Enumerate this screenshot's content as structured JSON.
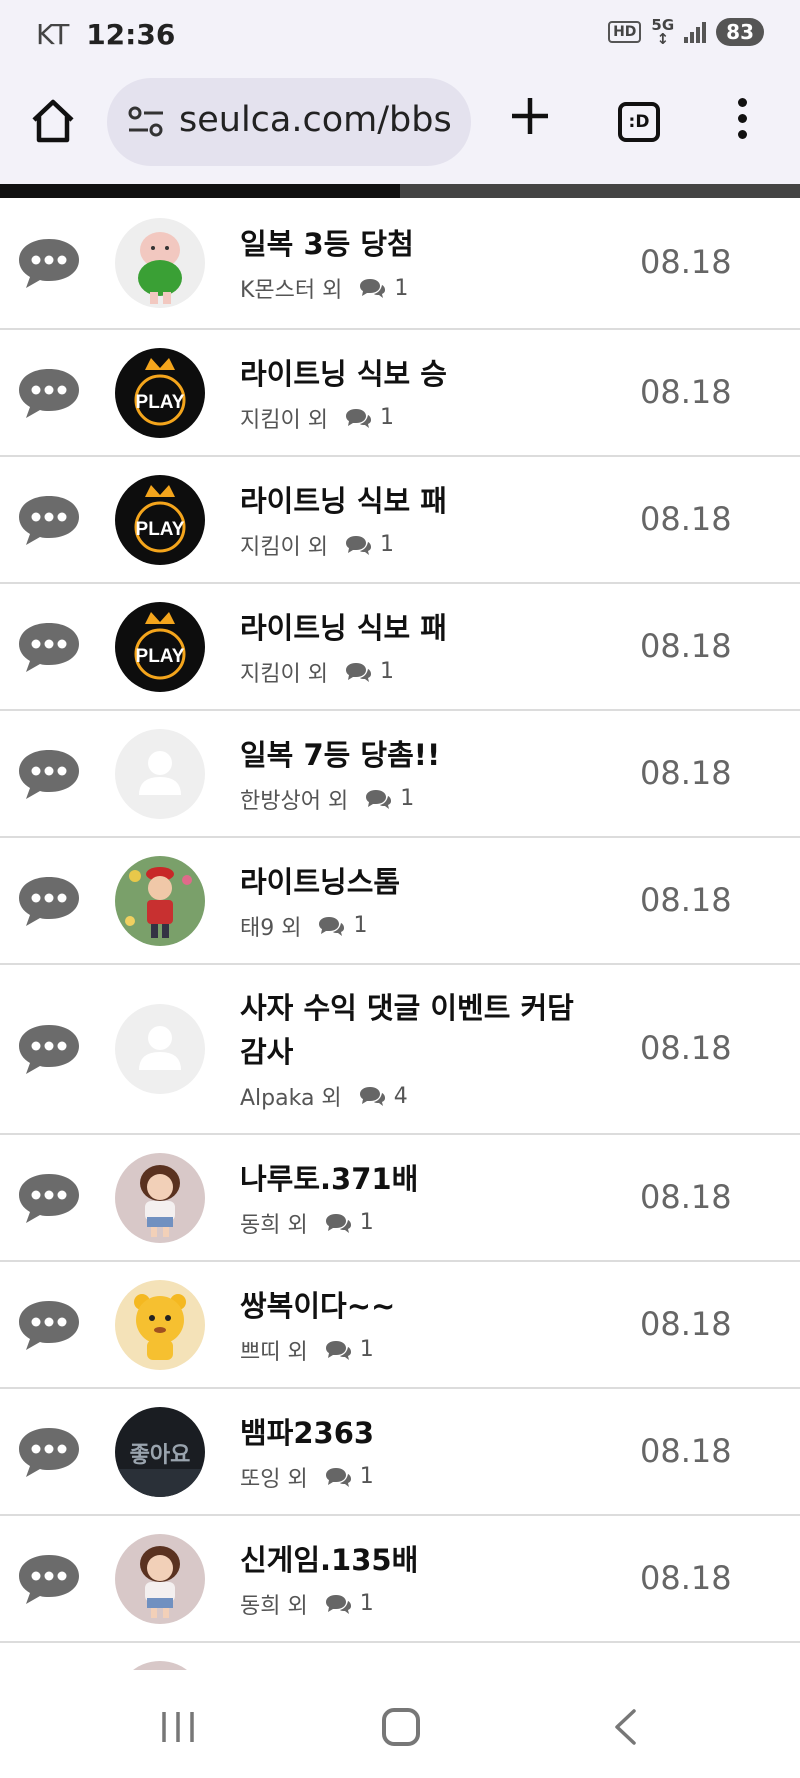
{
  "status_bar": {
    "carrier": "KT",
    "time": "12:36",
    "hd_label": "HD",
    "network_label": "5G",
    "battery": "83"
  },
  "browser": {
    "url": "seulca.com/bbs",
    "tabs_label": ":D",
    "progress": 0.5
  },
  "posts": [
    {
      "title": "일복 3등 당첨",
      "author": "K몬스터 외",
      "comments": "1",
      "date": "08.18",
      "avatar": "green-character-avatar"
    },
    {
      "title": "라이트닝 식보 승",
      "author": "지킴이 외",
      "comments": "1",
      "date": "08.18",
      "avatar": "play-logo-avatar"
    },
    {
      "title": "라이트닝 식보 패",
      "author": "지킴이 외",
      "comments": "1",
      "date": "08.18",
      "avatar": "play-logo-avatar"
    },
    {
      "title": "라이트닝 식보 패",
      "author": "지킴이 외",
      "comments": "1",
      "date": "08.18",
      "avatar": "play-logo-avatar"
    },
    {
      "title": "일복 7등 당촘!!",
      "author": "한방상어 외",
      "comments": "1",
      "date": "08.18",
      "avatar": "default-user-avatar"
    },
    {
      "title": "라이트닝스톰",
      "author": "태9 외",
      "comments": "1",
      "date": "08.18",
      "avatar": "boy-character-avatar"
    },
    {
      "title": "사자 수익 댓글 이벤트 커담 감사",
      "author": "Alpaka 외",
      "comments": "4",
      "date": "08.18",
      "avatar": "default-user-avatar"
    },
    {
      "title": "나루토.371배",
      "author": "동희 외",
      "comments": "1",
      "date": "08.18",
      "avatar": "girl-character-avatar"
    },
    {
      "title": "쌍복이다~~",
      "author": "쁘띠 외",
      "comments": "1",
      "date": "08.18",
      "avatar": "tiger-character-avatar"
    },
    {
      "title": "뱀파2363",
      "author": "또잉 외",
      "comments": "1",
      "date": "08.18",
      "avatar": "like-sign-avatar"
    },
    {
      "title": "신게임.135배",
      "author": "동희 외",
      "comments": "1",
      "date": "08.18",
      "avatar": "girl-character-avatar"
    },
    {
      "title": "",
      "author": "",
      "comments": "",
      "date": "",
      "avatar": "girl-character-avatar"
    }
  ],
  "colors": {
    "browser_bg": "#f3f2f9",
    "url_pill": "#e4e2ee",
    "chat_icon": "#6b6b6b",
    "divider": "#dcdcdc"
  }
}
